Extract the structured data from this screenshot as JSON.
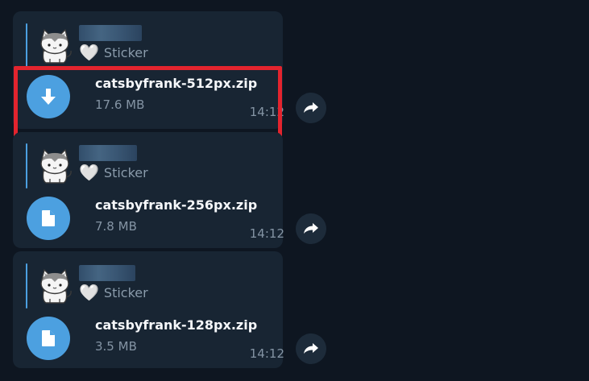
{
  "messages": [
    {
      "reply": {
        "sticker_icon": "cat-sticker",
        "heart": "🤍",
        "label": "Sticker"
      },
      "file": {
        "icon": "download-arrow-icon",
        "name": "catsbyfrank-512px.zip",
        "size": "17.6 MB",
        "time": "14:12"
      }
    },
    {
      "reply": {
        "sticker_icon": "cat-sticker",
        "heart": "🤍",
        "label": "Sticker"
      },
      "file": {
        "icon": "document-icon",
        "name": "catsbyfrank-256px.zip",
        "size": "7.8 MB",
        "time": "14:12"
      }
    },
    {
      "reply": {
        "sticker_icon": "cat-sticker",
        "heart": "🤍",
        "label": "Sticker"
      },
      "file": {
        "icon": "document-icon",
        "name": "catsbyfrank-128px.zip",
        "size": "3.5 MB",
        "time": "14:12"
      }
    }
  ],
  "colors": {
    "background": "#0e1621",
    "bubble": "#182533",
    "accent": "#4ca0e0",
    "highlight": "#e3242e"
  }
}
